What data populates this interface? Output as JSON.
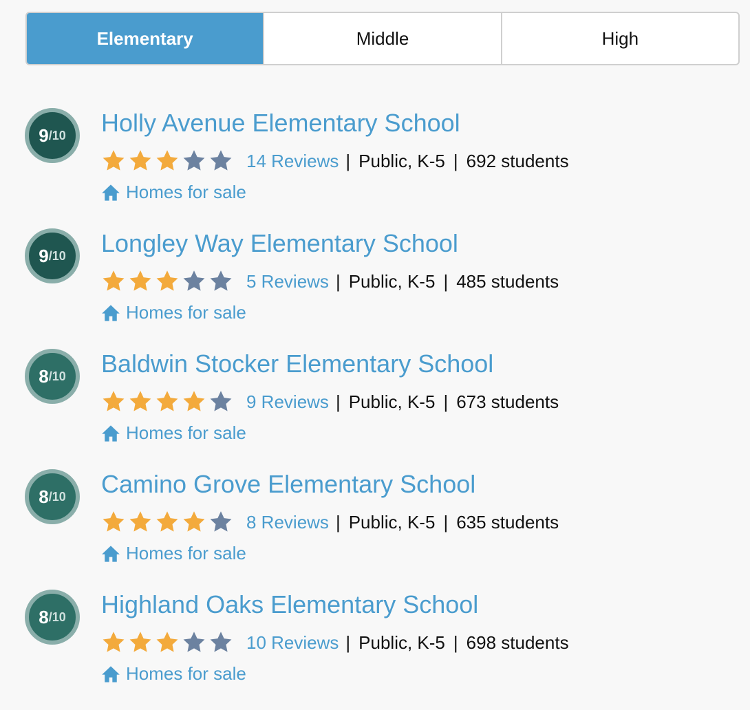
{
  "tabs": [
    {
      "label": "Elementary",
      "active": true
    },
    {
      "label": "Middle",
      "active": false
    },
    {
      "label": "High",
      "active": false
    }
  ],
  "colors": {
    "accent": "#4a9cce",
    "star_filled": "#f3aa3c",
    "star_empty": "#6c82a0",
    "badge_9": "#1f5650",
    "badge_8": "#2e6f66",
    "badge_ring": "#8aaeaa"
  },
  "schools": [
    {
      "rating": "9",
      "rating_den": "/10",
      "name": "Holly Avenue Elementary School",
      "stars": 3,
      "reviews": "14 Reviews",
      "type": "Public, K-5",
      "students": "692 students",
      "homes_link": "Homes for sale"
    },
    {
      "rating": "9",
      "rating_den": "/10",
      "name": "Longley Way Elementary School",
      "stars": 3,
      "reviews": "5 Reviews",
      "type": "Public, K-5",
      "students": "485 students",
      "homes_link": "Homes for sale"
    },
    {
      "rating": "8",
      "rating_den": "/10",
      "name": "Baldwin Stocker Elementary School",
      "stars": 4,
      "reviews": "9 Reviews",
      "type": "Public, K-5",
      "students": "673 students",
      "homes_link": "Homes for sale"
    },
    {
      "rating": "8",
      "rating_den": "/10",
      "name": "Camino Grove Elementary School",
      "stars": 4,
      "reviews": "8 Reviews",
      "type": "Public, K-5",
      "students": "635 students",
      "homes_link": "Homes for sale"
    },
    {
      "rating": "8",
      "rating_den": "/10",
      "name": "Highland Oaks Elementary School",
      "stars": 3,
      "reviews": "10 Reviews",
      "type": "Public, K-5",
      "students": "698 students",
      "homes_link": "Homes for sale"
    }
  ],
  "separator": "|"
}
